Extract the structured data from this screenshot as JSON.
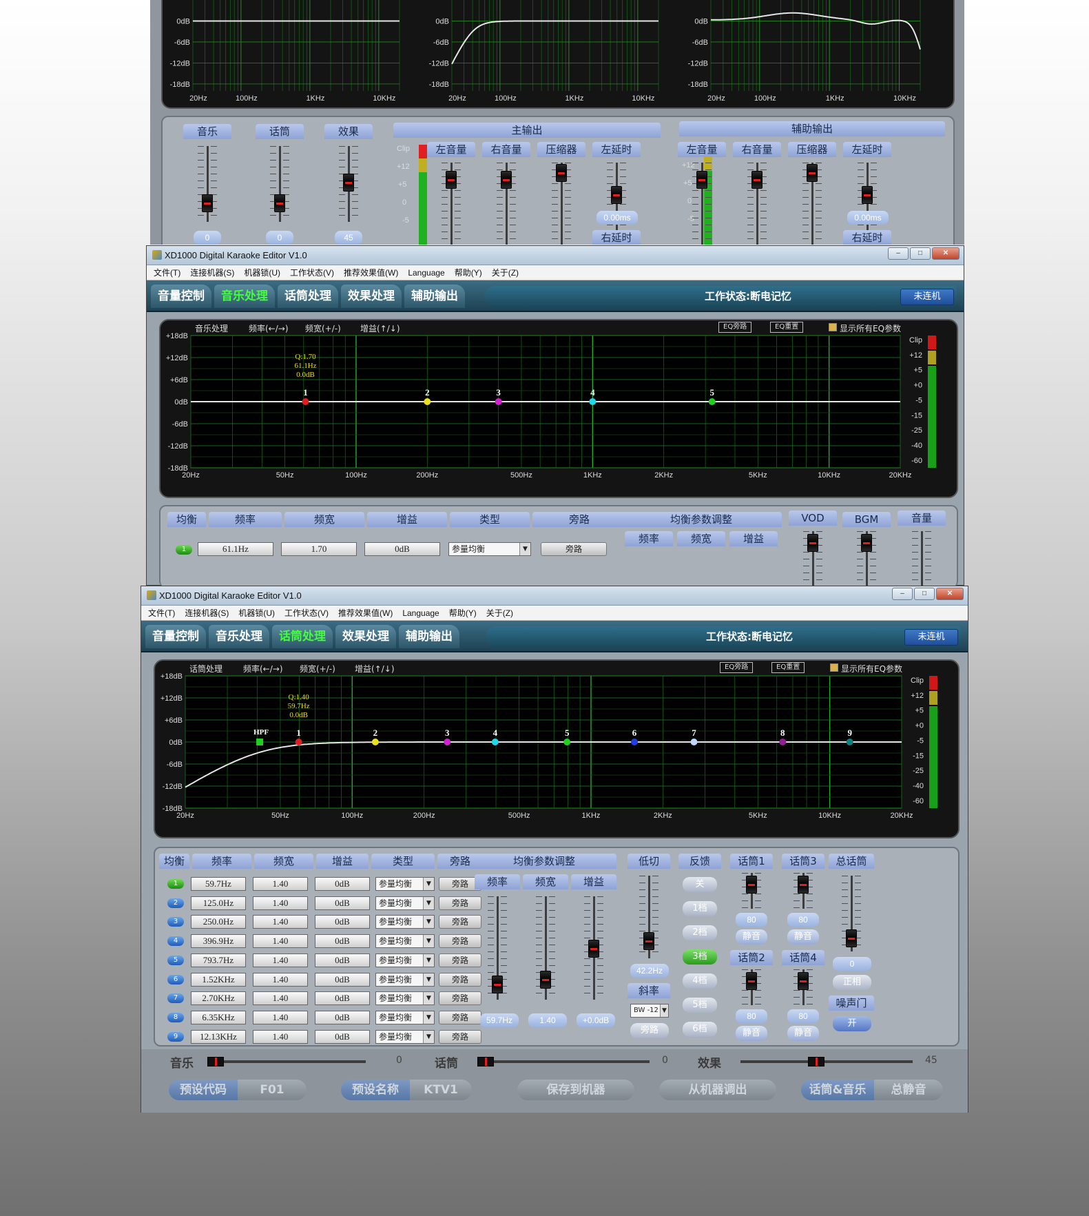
{
  "top_window": {
    "ylabels": [
      "0dB",
      "-6dB",
      "-12dB",
      "-18dB"
    ],
    "xlabels": [
      "20Hz",
      "100Hz",
      "1KHz",
      "10KHz"
    ],
    "groups": {
      "music": "音乐",
      "mic": "话筒",
      "effect": "效果",
      "main_out": "主输出",
      "aux_out": "辅助输出"
    },
    "group_values": {
      "music": "0",
      "mic": "0",
      "effect": "45"
    },
    "sub_labels": [
      "左音量",
      "右音量",
      "压缩器",
      "左延时"
    ],
    "right_delay": "右延时",
    "delay_value": "0.00ms",
    "meter_labels": [
      "Clip",
      "+12",
      "+5",
      "0",
      "-5"
    ]
  },
  "windows": [
    {
      "title": "XD1000 Digital Karaoke Editor V1.0",
      "menu": [
        "文件(T)",
        "连接机器(S)",
        "机器锁(U)",
        "工作状态(V)",
        "推荐效果值(W)",
        "Language",
        "帮助(Y)",
        "关于(Z)"
      ],
      "tabs": [
        "音量控制",
        "音乐处理",
        "话筒处理",
        "效果处理",
        "辅助输出"
      ],
      "active_tab": 1,
      "work_state": "工作状态:断电记忆",
      "connection": "未连机",
      "graph_header": {
        "name": "音乐处理",
        "freq": "频率(←/→)",
        "width": "频宽(+/-)",
        "gain": "增益(↑/↓)",
        "bypass_btn": "EQ旁路",
        "reset_btn": "EQ重置",
        "show_all": "显示所有EQ参数"
      },
      "ylabels": [
        "+18dB",
        "+12dB",
        "+6dB",
        "0dB",
        "-6dB",
        "-12dB",
        "-18dB"
      ],
      "xlabels": [
        "20Hz",
        "50Hz",
        "100Hz",
        "200Hz",
        "500Hz",
        "1KHz",
        "2KHz",
        "5KHz",
        "10KHz",
        "20KHz"
      ],
      "meter_labels": [
        "Clip",
        "+12",
        "+5",
        "+0",
        "-5",
        "-15",
        "-25",
        "-40",
        "-60"
      ],
      "selected_info": {
        "q": "Q:1.70",
        "freq": "61.1Hz",
        "gain": "0.0dB"
      },
      "points": [
        {
          "n": "1",
          "freq": 61.1,
          "color": "#e02020"
        },
        {
          "n": "2",
          "freq": 200,
          "color": "#e8e020"
        },
        {
          "n": "3",
          "freq": 400,
          "color": "#d020d0"
        },
        {
          "n": "4",
          "freq": 1000,
          "color": "#20d8e8"
        },
        {
          "n": "5",
          "freq": 3200,
          "color": "#20d020"
        }
      ],
      "table_headers": [
        "均衡",
        "频率",
        "频宽",
        "增益",
        "类型",
        "旁路"
      ],
      "row": {
        "num": "1",
        "freq": "61.1Hz",
        "q": "1.70",
        "gain": "0dB",
        "type": "参量均衡",
        "bypass": "旁路"
      },
      "adjust_title": "均衡参数调整",
      "adjust_cols": [
        "频率",
        "频宽",
        "增益"
      ],
      "extra_cols": [
        "VOD",
        "BGM",
        "音量"
      ]
    },
    {
      "title": "XD1000 Digital Karaoke Editor V1.0",
      "menu": [
        "文件(T)",
        "连接机器(S)",
        "机器锁(U)",
        "工作状态(V)",
        "推荐效果值(W)",
        "Language",
        "帮助(Y)",
        "关于(Z)"
      ],
      "tabs": [
        "音量控制",
        "音乐处理",
        "话筒处理",
        "效果处理",
        "辅助输出"
      ],
      "active_tab": 2,
      "work_state": "工作状态:断电记忆",
      "connection": "未连机",
      "graph_header": {
        "name": "话筒处理",
        "freq": "频率(←/→)",
        "width": "频宽(+/-)",
        "gain": "增益(↑/↓)",
        "bypass_btn": "EQ旁路",
        "reset_btn": "EQ重置",
        "show_all": "显示所有EQ参数"
      },
      "ylabels": [
        "+18dB",
        "+12dB",
        "+6dB",
        "0dB",
        "-6dB",
        "-12dB",
        "-18dB"
      ],
      "xlabels": [
        "20Hz",
        "50Hz",
        "100Hz",
        "200Hz",
        "500Hz",
        "1KHz",
        "2KHz",
        "5KHz",
        "10KHz",
        "20KHz"
      ],
      "meter_labels": [
        "Clip",
        "+12",
        "+5",
        "+0",
        "-5",
        "-15",
        "-25",
        "-40",
        "-60"
      ],
      "selected_info": {
        "q": "Q:1.40",
        "freq": "59.7Hz",
        "gain": "0.0dB"
      },
      "hpf_label": "HPF",
      "points": [
        {
          "n": "1",
          "freq": 59.7,
          "color": "#e02020"
        },
        {
          "n": "2",
          "freq": 125,
          "color": "#e8e020"
        },
        {
          "n": "3",
          "freq": 250,
          "color": "#d020d0"
        },
        {
          "n": "4",
          "freq": 396.9,
          "color": "#20d8e8"
        },
        {
          "n": "5",
          "freq": 793.7,
          "color": "#20d020"
        },
        {
          "n": "6",
          "freq": 1520,
          "color": "#2040e0"
        },
        {
          "n": "7",
          "freq": 2700,
          "color": "#c0d8ff"
        },
        {
          "n": "8",
          "freq": 6350,
          "color": "#902090"
        },
        {
          "n": "9",
          "freq": 12130,
          "color": "#108080"
        }
      ],
      "table_headers": [
        "均衡",
        "频率",
        "频宽",
        "增益",
        "类型",
        "旁路"
      ],
      "rows": [
        {
          "num": "1",
          "freq": "59.7Hz",
          "q": "1.40",
          "gain": "0dB",
          "type": "参量均衡",
          "bypass": "旁路"
        },
        {
          "num": "2",
          "freq": "125.0Hz",
          "q": "1.40",
          "gain": "0dB",
          "type": "参量均衡",
          "bypass": "旁路"
        },
        {
          "num": "3",
          "freq": "250.0Hz",
          "q": "1.40",
          "gain": "0dB",
          "type": "参量均衡",
          "bypass": "旁路"
        },
        {
          "num": "4",
          "freq": "396.9Hz",
          "q": "1.40",
          "gain": "0dB",
          "type": "参量均衡",
          "bypass": "旁路"
        },
        {
          "num": "5",
          "freq": "793.7Hz",
          "q": "1.40",
          "gain": "0dB",
          "type": "参量均衡",
          "bypass": "旁路"
        },
        {
          "num": "6",
          "freq": "1.52KHz",
          "q": "1.40",
          "gain": "0dB",
          "type": "参量均衡",
          "bypass": "旁路"
        },
        {
          "num": "7",
          "freq": "2.70KHz",
          "q": "1.40",
          "gain": "0dB",
          "type": "参量均衡",
          "bypass": "旁路"
        },
        {
          "num": "8",
          "freq": "6.35KHz",
          "q": "1.40",
          "gain": "0dB",
          "type": "参量均衡",
          "bypass": "旁路"
        },
        {
          "num": "9",
          "freq": "12.13KHz",
          "q": "1.40",
          "gain": "0dB",
          "type": "参量均衡",
          "bypass": "旁路"
        }
      ],
      "adjust_title": "均衡参数调整",
      "adjust_cols": [
        "频率",
        "频宽",
        "增益"
      ],
      "adjust_values": [
        "59.7Hz",
        "1.40",
        "+0.0dB"
      ],
      "lowcut": {
        "title": "低切",
        "value": "42.2Hz",
        "slope_title": "斜率",
        "slope": "BW -12",
        "bypass": "旁路"
      },
      "feedback": {
        "title": "反馈",
        "options": [
          "关",
          "1档",
          "2档",
          "3档",
          "4档",
          "5档",
          "6档"
        ],
        "active": 3
      },
      "mics": [
        {
          "title": "话筒1",
          "value": "80",
          "mute": "静音"
        },
        {
          "title": "话筒3",
          "value": "80",
          "mute": "静音"
        },
        {
          "title": "话筒2",
          "value": "80",
          "mute": "静音"
        },
        {
          "title": "话筒4",
          "value": "80",
          "mute": "静音"
        }
      ],
      "total_mic": {
        "title": "总话筒",
        "value": "0",
        "phase": "正相",
        "gate_title": "噪声门",
        "gate": "开"
      },
      "bottom": {
        "music": "音乐",
        "music_val": "0",
        "mic": "话筒",
        "mic_val": "0",
        "effect": "效果",
        "effect_val": "45"
      },
      "buttons": {
        "preset_code": "预设代码",
        "code_val": "F01",
        "preset_name": "预设名称",
        "name_val": "KTV1",
        "save": "保存到机器",
        "load": "从机器调出",
        "mic_music": "话筒&音乐",
        "mute_all": "总静音"
      }
    }
  ]
}
